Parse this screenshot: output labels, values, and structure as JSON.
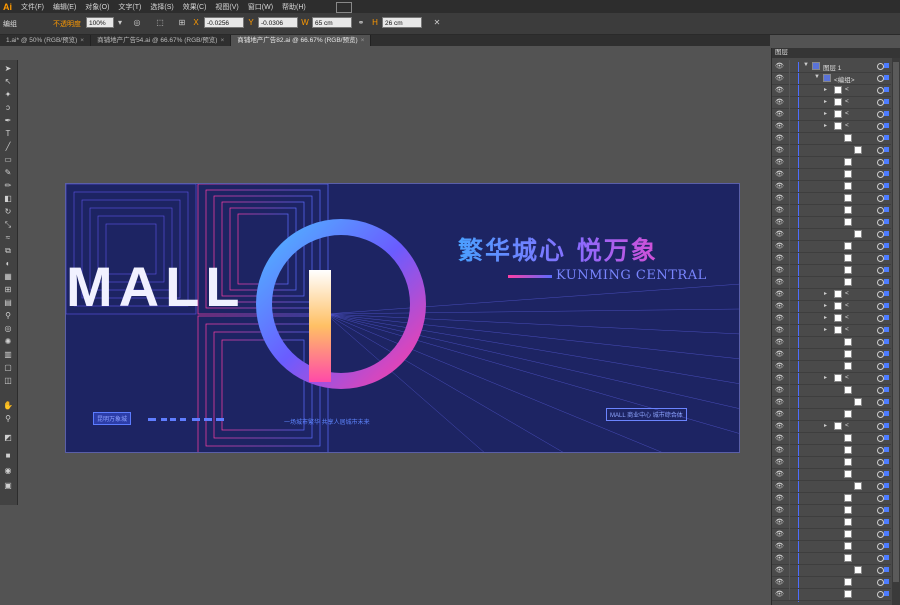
{
  "app": {
    "logo": "Ai"
  },
  "menu": [
    "文件(F)",
    "编辑(E)",
    "对象(O)",
    "文字(T)",
    "选择(S)",
    "效果(C)",
    "视图(V)",
    "窗口(W)",
    "帮助(H)"
  ],
  "control_bar": {
    "selection_label": "编组",
    "opacity_label": "不透明度",
    "opacity_value": "100%",
    "x_value": "-0.0256",
    "y_value": "-0.0306",
    "width_value": "65 cm",
    "height_value": "26 cm"
  },
  "tabs": [
    {
      "label": "1.ai* @ 50% (RGB/预览)",
      "active": false
    },
    {
      "label": "商铺地产广告54.ai @ 66.67% (RGB/预览)",
      "active": false
    },
    {
      "label": "商铺地产广告82.ai @ 66.67% (RGB/预览)",
      "active": true
    }
  ],
  "artwork": {
    "title_cn": "繁华城心  悦万象",
    "title_en": "KUNMING CENTRAL",
    "mall_text": "MALL",
    "tag_left": "昆明万象城",
    "tag_mid": "一场城市繁华 共享人居城市未来",
    "tag_right": "MALL 商业中心 城市综合体"
  },
  "layers_panel": {
    "title": "图层",
    "layer1_name": "图层 1",
    "group_name": "<编组>",
    "item_name": "<"
  },
  "colors": {
    "accent_blue": "#4d7cff",
    "artboard_bg": "#1d2463",
    "logo_orange": "#ff9a00"
  }
}
